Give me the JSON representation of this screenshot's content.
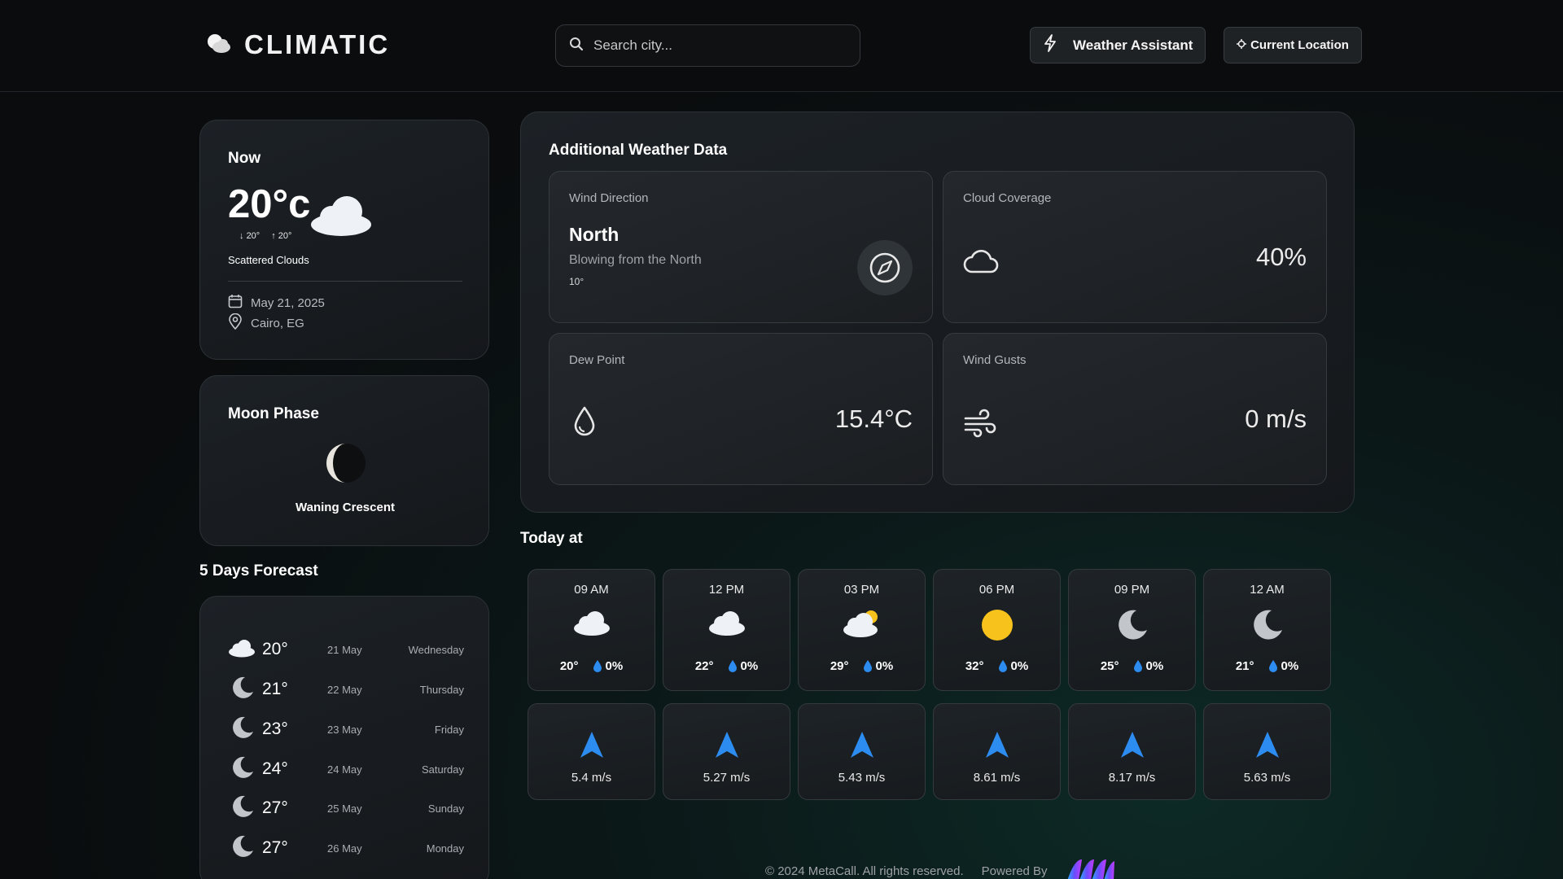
{
  "header": {
    "brand": "CLIMATIC",
    "search_placeholder": "Search city...",
    "assistant_label": "Weather Assistant",
    "location_label": "Current Location"
  },
  "now": {
    "title": "Now",
    "temp": "20°c",
    "min": "20°",
    "max": "20°",
    "description": "Scattered Clouds",
    "date": "May 21, 2025",
    "location": "Cairo, EG"
  },
  "moon": {
    "title": "Moon Phase",
    "phase": "Waning Crescent"
  },
  "forecast": {
    "title": "5 Days Forecast",
    "days": [
      {
        "icon": "cloud-icon",
        "temp": "20°",
        "date": "21 May",
        "day": "Wednesday"
      },
      {
        "icon": "moon-icon",
        "temp": "21°",
        "date": "22 May",
        "day": "Thursday"
      },
      {
        "icon": "moon-icon",
        "temp": "23°",
        "date": "23 May",
        "day": "Friday"
      },
      {
        "icon": "moon-icon",
        "temp": "24°",
        "date": "24 May",
        "day": "Saturday"
      },
      {
        "icon": "moon-icon",
        "temp": "27°",
        "date": "25 May",
        "day": "Sunday"
      },
      {
        "icon": "moon-icon",
        "temp": "27°",
        "date": "26 May",
        "day": "Monday"
      }
    ]
  },
  "additional": {
    "title": "Additional Weather Data",
    "wind_direction": {
      "label": "Wind Direction",
      "value": "North",
      "subtitle": "Blowing from the North",
      "degrees": "10°"
    },
    "cloud_coverage": {
      "label": "Cloud Coverage",
      "value": "40%"
    },
    "dew_point": {
      "label": "Dew Point",
      "value": "15.4°C"
    },
    "wind_gusts": {
      "label": "Wind Gusts",
      "value": "0 m/s"
    }
  },
  "today": {
    "title": "Today at",
    "hours": [
      {
        "time": "09 AM",
        "icon": "cloud-icon",
        "temp": "20°",
        "pop": "0%",
        "wind": "5.4 m/s"
      },
      {
        "time": "12 PM",
        "icon": "cloud-icon",
        "temp": "22°",
        "pop": "0%",
        "wind": "5.27 m/s"
      },
      {
        "time": "03 PM",
        "icon": "partly-sunny-icon",
        "temp": "29°",
        "pop": "0%",
        "wind": "5.43 m/s"
      },
      {
        "time": "06 PM",
        "icon": "sun-icon",
        "temp": "32°",
        "pop": "0%",
        "wind": "8.61 m/s"
      },
      {
        "time": "09 PM",
        "icon": "moon-icon",
        "temp": "25°",
        "pop": "0%",
        "wind": "8.17 m/s"
      },
      {
        "time": "12 AM",
        "icon": "moon-icon",
        "temp": "21°",
        "pop": "0%",
        "wind": "5.63 m/s"
      }
    ]
  },
  "footer": {
    "copyright": "© 2024 MetaCall. All rights reserved.",
    "powered_by": "Powered By"
  },
  "colors": {
    "accent_blue": "#2d8cf0",
    "sun_yellow": "#f7c21b",
    "moon_gray": "#c2c6cb"
  }
}
